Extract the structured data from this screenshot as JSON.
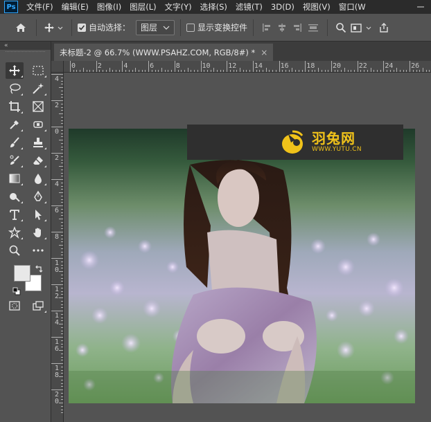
{
  "app": {
    "logo_text": "Ps",
    "colors": {
      "ui_dark": "#2b2b2b",
      "ui_panel": "#535353",
      "accent": "#31a8ff",
      "watermark_yellow": "#f0c21a"
    }
  },
  "menu": {
    "items": [
      "文件(F)",
      "编辑(E)",
      "图像(I)",
      "图层(L)",
      "文字(Y)",
      "选择(S)",
      "滤镜(T)",
      "3D(D)",
      "视图(V)",
      "窗口(W"
    ]
  },
  "options": {
    "auto_select_label": "自动选择：",
    "auto_select_value": "图层",
    "show_transform_label": "显示变换控件",
    "auto_select_checked": true,
    "show_transform_checked": false
  },
  "toolbar": {
    "collapse_label": "«",
    "tools": [
      "move-icon",
      "marquee-icon",
      "lasso-icon",
      "magic-wand-icon",
      "crop-icon",
      "frame-icon",
      "eyedropper-icon",
      "spot-healing-icon",
      "brush-icon",
      "stamp-icon",
      "history-brush-icon",
      "eraser-icon",
      "gradient-icon",
      "blur-icon",
      "dodge-icon",
      "pen-icon",
      "type-icon",
      "path-select-icon",
      "custom-shape-icon",
      "hand-icon",
      "zoom-icon",
      "more-tools-icon"
    ],
    "foreground_color": "#e8e8e8",
    "background_color": "#ffffff"
  },
  "document": {
    "tab_title": "未标题-2 @ 66.7% (WWW.PSAHZ.COM, RGB/8#) *",
    "close_glyph": "×"
  },
  "rulers": {
    "top_labels": [
      "0",
      "2",
      "4",
      "6",
      "8",
      "10",
      "12",
      "14",
      "16",
      "18",
      "20",
      "22",
      "24",
      "26"
    ],
    "left_labels": [
      "4",
      "2",
      "0",
      "2",
      "4",
      "6",
      "8",
      "1 0",
      "1 2",
      "1 4",
      "1 6",
      "1 8",
      "2 0"
    ]
  },
  "watermark": {
    "brand": "羽兔网",
    "url": "WWW.YUTU.CN"
  }
}
